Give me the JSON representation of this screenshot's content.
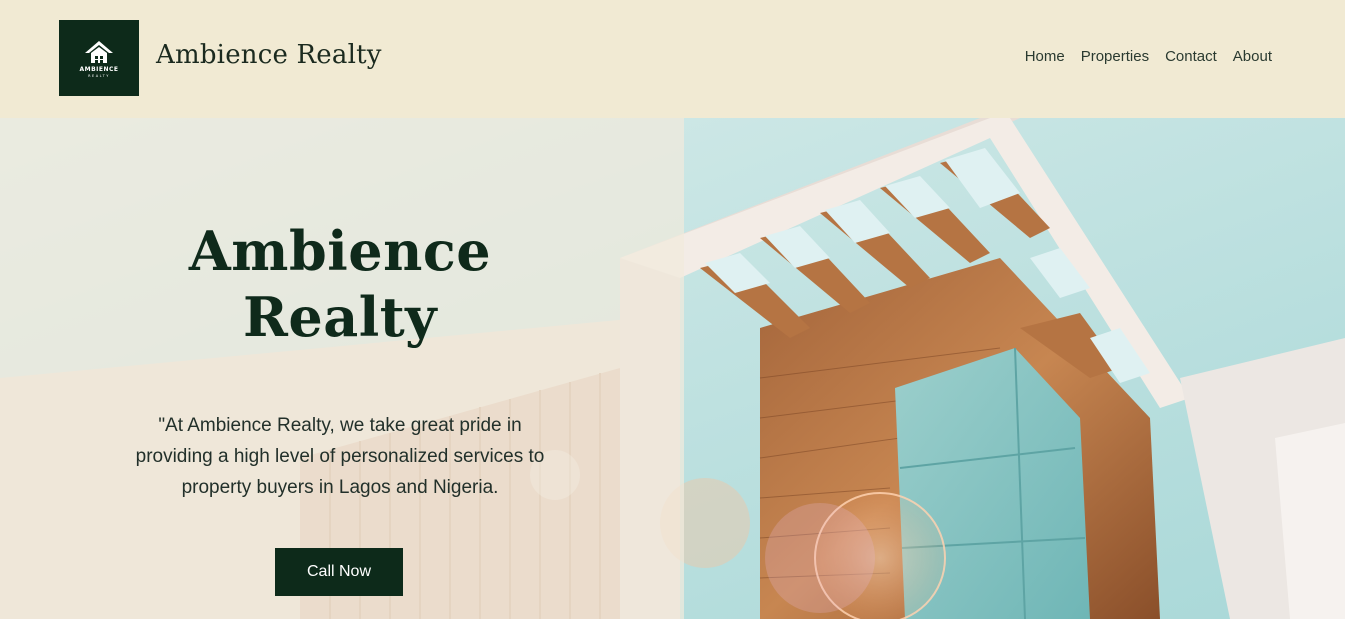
{
  "header": {
    "logo": {
      "icon": "house-icon",
      "wordmark": "AMBIENCE",
      "subtext": "REALTY",
      "background": "#0d2a1a"
    },
    "site_title": "Ambience Realty",
    "nav": [
      {
        "label": "Home"
      },
      {
        "label": "Properties"
      },
      {
        "label": "Contact"
      },
      {
        "label": "About"
      }
    ],
    "background": "#f1ead3"
  },
  "hero": {
    "title_line1": "Ambience",
    "title_line2": "Realty",
    "tagline": "\"At Ambience Realty, we take great pride in providing a high level of personalized services to property buyers in Lagos and Nigeria.",
    "cta_label": "Call Now",
    "accent": "#0d2a1a",
    "image": "modern-building-photo"
  }
}
